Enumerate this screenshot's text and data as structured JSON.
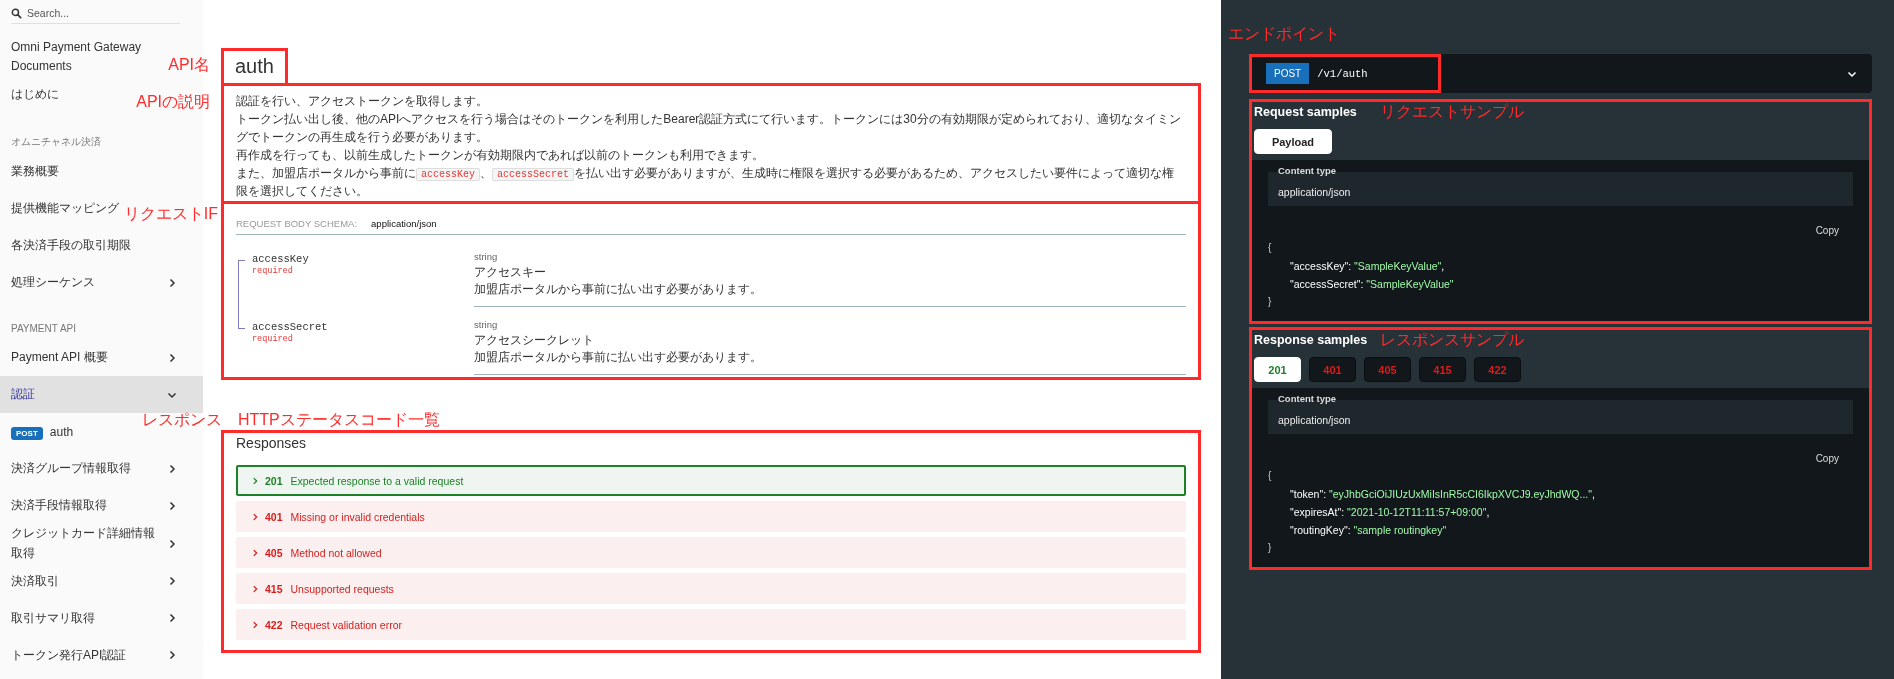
{
  "sidebar": {
    "search": {
      "placeholder": "Search..."
    },
    "items": [
      {
        "kind": "link",
        "label": "Omni Payment Gateway Documents",
        "selected": false
      },
      {
        "kind": "link",
        "label": "はじめに",
        "selected": false
      },
      {
        "kind": "heading",
        "label": "オムニチャネル決済"
      },
      {
        "kind": "link",
        "label": "業務概要",
        "selected": false
      },
      {
        "kind": "link",
        "label": "提供機能マッピング",
        "selected": false
      },
      {
        "kind": "link",
        "label": "各決済手段の取引期限",
        "selected": false
      },
      {
        "kind": "link",
        "label": "処理シーケンス",
        "selected": false,
        "expanded": false
      },
      {
        "kind": "heading",
        "label": "PAYMENT API"
      },
      {
        "kind": "link",
        "label": "Payment API 概要",
        "selected": false,
        "expanded": false
      },
      {
        "kind": "link",
        "label": "認証",
        "selected": true,
        "expanded": true
      },
      {
        "kind": "operation",
        "method": "POST",
        "label": "auth",
        "selected": false
      },
      {
        "kind": "link",
        "label": "決済グループ情報取得",
        "selected": false,
        "expanded": false
      },
      {
        "kind": "link",
        "label": "決済手段情報取得",
        "selected": false,
        "expanded": false
      },
      {
        "kind": "link",
        "label": "クレジットカード詳細情報取得",
        "selected": false,
        "expanded": false
      },
      {
        "kind": "link",
        "label": "決済取引",
        "selected": false,
        "expanded": false
      },
      {
        "kind": "link",
        "label": "取引サマリ取得",
        "selected": false,
        "expanded": false
      },
      {
        "kind": "link",
        "label": "トークン発行API認証",
        "selected": false,
        "expanded": false
      }
    ]
  },
  "operation": {
    "title": "auth",
    "title_annotation": "API名",
    "description_annotation": "APIの説明",
    "description": [
      [
        {
          "kind": "text",
          "text": "認証を行い、アクセストークンを取得します。"
        }
      ],
      [
        {
          "kind": "text",
          "text": "トークン払い出し後、他のAPIへアクセスを行う場合はそのトークンを利用したBearer認証方式にて行います。トークンには30分の有効期限が定められており、適切なタイミングでトークンの再生成を行う必要があります。"
        }
      ],
      [
        {
          "kind": "text",
          "text": "再作成を行っても、以前生成したトークンが有効期限内であれば以前のトークンも利用できます。"
        }
      ],
      [
        {
          "kind": "text",
          "text": "また、加盟店ポータルから事前に"
        },
        {
          "kind": "code",
          "text": "accessKey"
        },
        {
          "kind": "text",
          "text": "、"
        },
        {
          "kind": "code",
          "text": "accessSecret"
        },
        {
          "kind": "text",
          "text": "を払い出す必要がありますが、生成時に権限を選択する必要があるため、アクセスしたい要件によって適切な権限を選択してください。"
        }
      ]
    ],
    "schema": {
      "annotation": "リクエストIF",
      "label": "REQUEST BODY SCHEMA:",
      "content_type": "application/json",
      "fields": [
        {
          "name": "accessKey",
          "required": "required",
          "type": "string",
          "title": "アクセスキー",
          "description": "加盟店ポータルから事前に払い出す必要があります。"
        },
        {
          "name": "accessSecret",
          "required": "required",
          "type": "string",
          "title": "アクセスシークレット",
          "description": "加盟店ポータルから事前に払い出す必要があります。"
        }
      ]
    },
    "responses": {
      "annotation": "レスポンス　HTTPステータスコード一覧",
      "title": "Responses",
      "items": [
        {
          "kind": "success",
          "code": "201",
          "text": "Expected response to a valid request",
          "selected": true
        },
        {
          "kind": "error",
          "code": "401",
          "text": "Missing or invalid credentials",
          "selected": false
        },
        {
          "kind": "error",
          "code": "405",
          "text": "Method not allowed",
          "selected": false
        },
        {
          "kind": "error",
          "code": "415",
          "text": "Unsupported requests",
          "selected": false
        },
        {
          "kind": "error",
          "code": "422",
          "text": "Request validation error",
          "selected": false
        }
      ]
    }
  },
  "endpoint": {
    "annotation": "エンドポイント",
    "method": "POST",
    "path": "/v1/auth"
  },
  "request_samples": {
    "annotation": "リクエストサンプル",
    "title": "Request samples",
    "tabs": [
      {
        "label": "Payload",
        "selected": true,
        "kind": "neutral"
      }
    ],
    "content_type_label": "Content type",
    "content_type": "application/json",
    "copy": "Copy",
    "open": "{",
    "close": "}",
    "lines": [
      {
        "key": "\"accessKey\": ",
        "value": "\"SampleKeyValue\"",
        "trail": ","
      },
      {
        "key": "\"accessSecret\": ",
        "value": "\"SampleKeyValue\""
      }
    ]
  },
  "response_samples": {
    "annotation": "レスポンスサンプル",
    "title": "Response samples",
    "tabs": [
      {
        "label": "201",
        "selected": true,
        "kind": "success"
      },
      {
        "label": "401",
        "selected": false,
        "kind": "error"
      },
      {
        "label": "405",
        "selected": false,
        "kind": "error"
      },
      {
        "label": "415",
        "selected": false,
        "kind": "error"
      },
      {
        "label": "422",
        "selected": false,
        "kind": "error"
      }
    ],
    "content_type_label": "Content type",
    "content_type": "application/json",
    "copy": "Copy",
    "open": "{",
    "close": "}",
    "lines": [
      {
        "key": "\"token\": ",
        "value": "\"eyJhbGciOiJIUzUxMiIsInR5cCI6IkpXVCJ9.eyJhdWQ...\"",
        "trail": ","
      },
      {
        "key": "\"expiresAt\": ",
        "value": "\"2021-10-12T11:11:57+09:00\"",
        "trail": ","
      },
      {
        "key": "\"routingKey\": ",
        "value": "\"sample routingkey\""
      }
    ]
  }
}
